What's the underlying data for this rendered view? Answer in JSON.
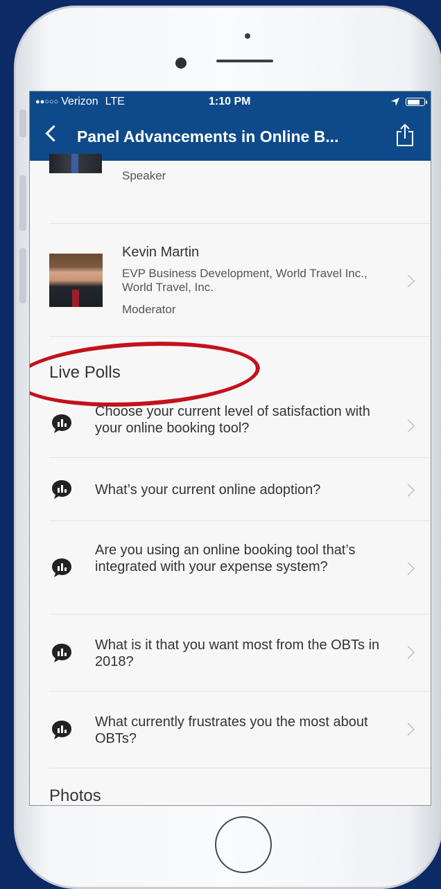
{
  "status": {
    "carrier": "Verizon",
    "network": "LTE",
    "time": "1:10 PM"
  },
  "nav": {
    "title": "Panel Advancements in Online B..."
  },
  "speakers": [
    {
      "role": "Speaker"
    },
    {
      "name": "Kevin Martin",
      "title": "EVP Business Development, World Travel Inc., World Travel, Inc.",
      "role": "Moderator"
    }
  ],
  "polls": {
    "heading": "Live Polls",
    "items": [
      "Choose your current level of satisfaction with your online booking tool?",
      "What’s your current online adoption?",
      "Are you using an online booking tool that’s integrated with your expense system?",
      "What is it that you want most from the OBTs in 2018?",
      "What currently frustrates you the most about OBTs?"
    ]
  },
  "photos": {
    "heading": "Photos"
  },
  "colors": {
    "nav_bg": "#0e4a8a",
    "annotation_oval": "#c3121c",
    "page_bg": "#0c2a66"
  }
}
